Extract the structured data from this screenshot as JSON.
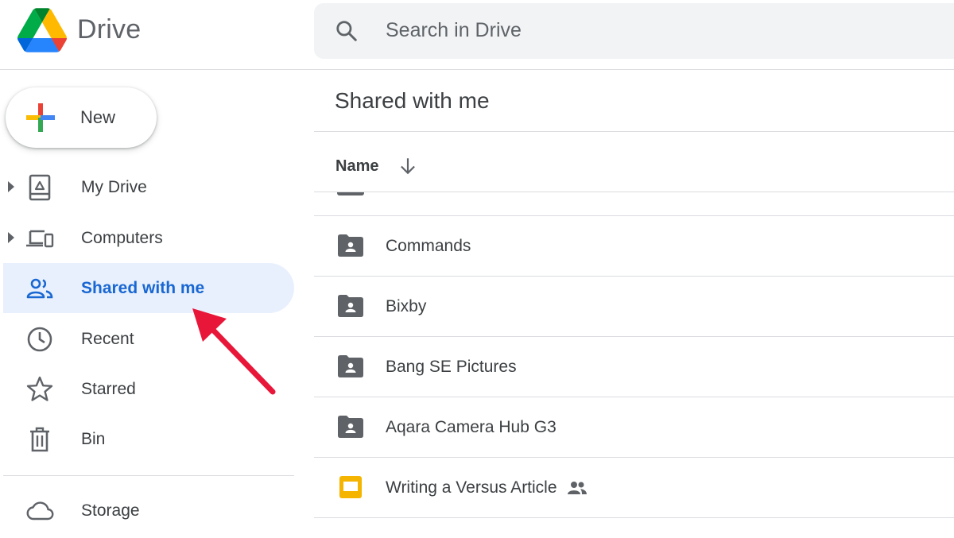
{
  "app": {
    "brand": "Drive"
  },
  "search": {
    "placeholder": "Search in Drive"
  },
  "sidebar": {
    "new_label": "New",
    "items": [
      {
        "label": "My Drive",
        "icon": "my-drive-icon",
        "expandable": true,
        "active": false
      },
      {
        "label": "Computers",
        "icon": "computers-icon",
        "expandable": true,
        "active": false
      },
      {
        "label": "Shared with me",
        "icon": "shared-people-icon",
        "expandable": false,
        "active": true
      },
      {
        "label": "Recent",
        "icon": "clock-icon",
        "expandable": false,
        "active": false
      },
      {
        "label": "Starred",
        "icon": "star-icon",
        "expandable": false,
        "active": false
      },
      {
        "label": "Bin",
        "icon": "trash-icon",
        "expandable": false,
        "active": false
      }
    ],
    "storage_label": "Storage"
  },
  "main": {
    "title": "Shared with me",
    "column_name": "Name",
    "files": [
      {
        "name": "Commands",
        "type": "shared-folder"
      },
      {
        "name": "Bixby",
        "type": "shared-folder"
      },
      {
        "name": "Bang SE Pictures",
        "type": "shared-folder"
      },
      {
        "name": "Aqara Camera Hub G3",
        "type": "shared-folder"
      },
      {
        "name": "Writing a Versus Article",
        "type": "slides",
        "shared": true
      }
    ]
  },
  "colors": {
    "accent": "#1967d2",
    "active_bg": "#e8f0fe",
    "icon_gray": "#5f6368",
    "slides_yellow": "#f4b400",
    "annotation_red": "#e8173a"
  }
}
